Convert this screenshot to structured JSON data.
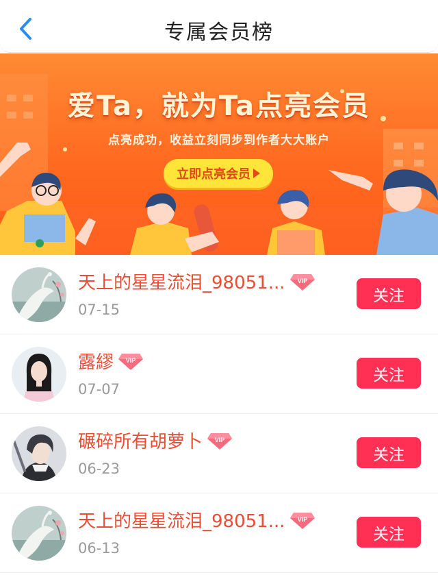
{
  "header": {
    "title": "专属会员榜",
    "back_icon": "chevron-left-icon",
    "accent": "#2a8cf0"
  },
  "banner": {
    "headline": "爱Ta，就为Ta点亮会员",
    "subtitle": "点亮成功，收益立刻同步到作者大大账户",
    "cta_label": "立即点亮会员",
    "background": "#ff6a20"
  },
  "members": [
    {
      "name": "天上的星星流泪_98051...",
      "date": "07-15",
      "badge": "VIP",
      "follow_label": "关注",
      "avatar": "crane-painting-avatar"
    },
    {
      "name": "露繆",
      "date": "07-07",
      "badge": "VIP",
      "follow_label": "关注",
      "avatar": "girl-portrait-avatar"
    },
    {
      "name": "碾碎所有胡萝卜",
      "date": "06-23",
      "badge": "VIP",
      "follow_label": "关注",
      "avatar": "anime-boy-avatar"
    },
    {
      "name": "天上的星星流泪_98051...",
      "date": "06-13",
      "badge": "VIP",
      "follow_label": "关注",
      "avatar": "crane-painting-avatar"
    }
  ],
  "colors": {
    "name_text": "#e94d35",
    "follow_button": "#ff3054",
    "date_text": "#9a9a9a"
  }
}
